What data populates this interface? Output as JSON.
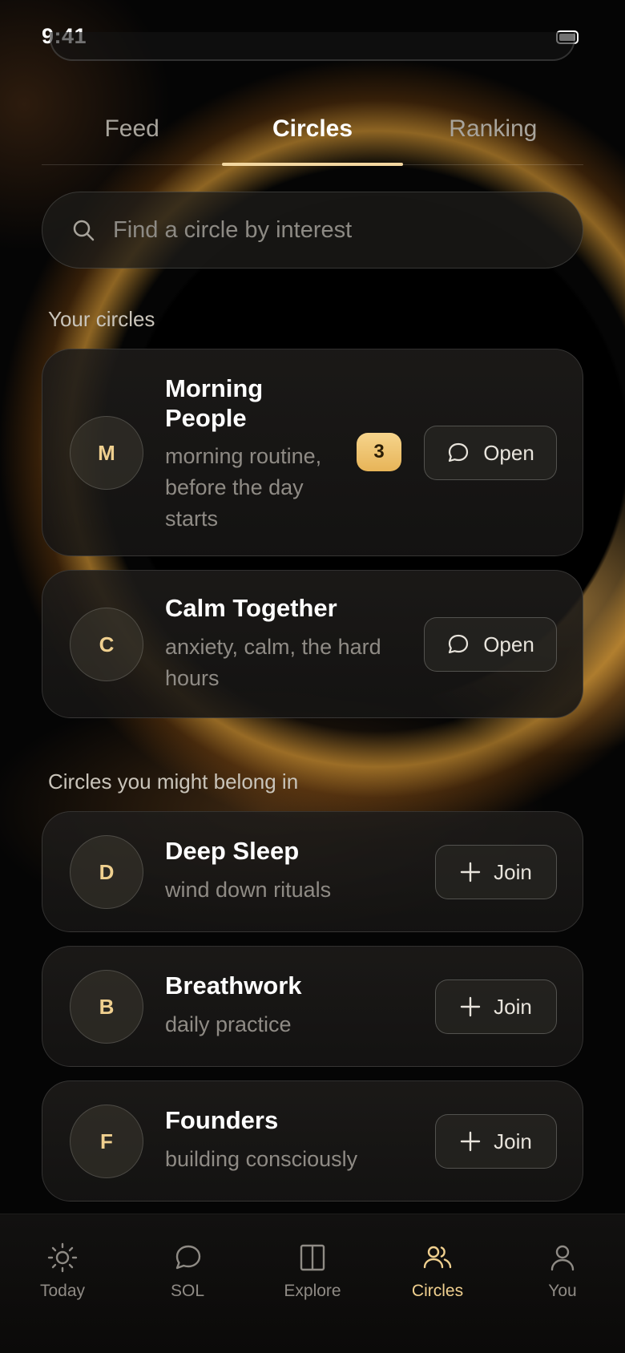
{
  "status_bar": {
    "time": "9:41"
  },
  "tabs": [
    {
      "label": "Feed",
      "active": false
    },
    {
      "label": "Circles",
      "active": true
    },
    {
      "label": "Ranking",
      "active": false
    }
  ],
  "search": {
    "placeholder": "Find a circle by interest",
    "icon": "search-icon"
  },
  "your_circles": {
    "title": "Your circles",
    "items": [
      {
        "initial": "M",
        "name_line1": "Morning",
        "name_line2": "People",
        "sub_line1": "morning routine,",
        "sub_line2": "before the day",
        "sub_line3": "starts",
        "badge": "3",
        "action": "Open",
        "action_icon": "chat-bubble-icon"
      },
      {
        "initial": "C",
        "name": "Calm Together",
        "sub_line1": "anxiety, calm, the hard",
        "sub_line2": "hours",
        "action": "Open",
        "action_icon": "chat-bubble-icon"
      }
    ]
  },
  "suggested": {
    "title": "Circles you might belong in",
    "items": [
      {
        "initial": "D",
        "name": "Deep Sleep",
        "sub": "wind down rituals",
        "action": "Join",
        "action_icon": "plus-icon"
      },
      {
        "initial": "B",
        "name": "Breathwork",
        "sub": "daily practice",
        "action": "Join",
        "action_icon": "plus-icon"
      },
      {
        "initial": "F",
        "name": "Founders",
        "sub": "building consciously",
        "action": "Join",
        "action_icon": "plus-icon"
      }
    ]
  },
  "bottom_nav": [
    {
      "label": "Today",
      "icon": "sun-icon",
      "active": false
    },
    {
      "label": "SOL",
      "icon": "chat-bubble-icon",
      "active": false
    },
    {
      "label": "Explore",
      "icon": "book-icon",
      "active": false
    },
    {
      "label": "Circles",
      "icon": "people-icon",
      "active": true
    },
    {
      "label": "You",
      "icon": "person-icon",
      "active": false
    }
  ],
  "colors": {
    "accent": "#f0d08f",
    "badge": "#f3c56f",
    "background": "#050505"
  }
}
